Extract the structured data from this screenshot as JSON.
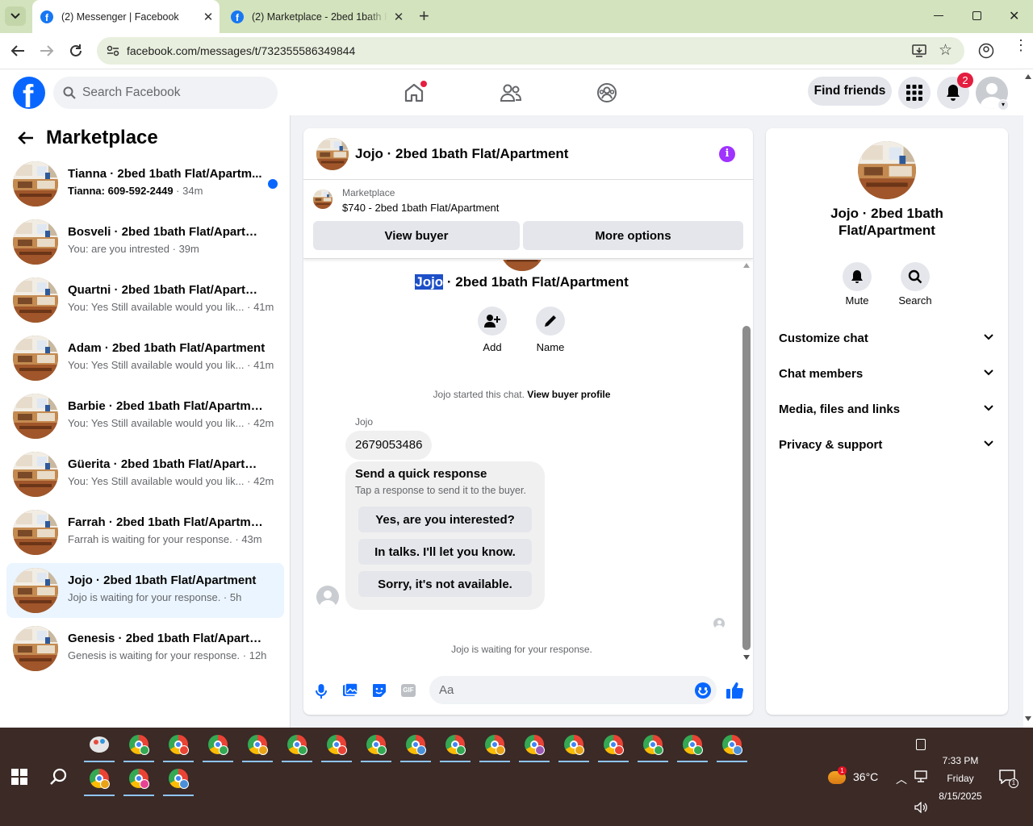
{
  "browser": {
    "tabs": [
      {
        "title": "(2) Messenger | Facebook",
        "active": true
      },
      {
        "title": "(2) Marketplace - 2bed 1bath Fl",
        "active": false
      }
    ],
    "url": "facebook.com/messages/t/732355586349844"
  },
  "fb_header": {
    "search_placeholder": "Search Facebook",
    "find_friends": "Find friends",
    "notif_count": "2"
  },
  "sidebar": {
    "title": "Marketplace",
    "conversations": [
      {
        "name": "Tianna · 2bed 1bath Flat/Apartm...",
        "preview": "Tianna: 609-592-2449",
        "time": "34m",
        "unread": true
      },
      {
        "name": "Bosveli · 2bed 1bath Flat/Apartment",
        "preview": "You: are you intrested",
        "time": "39m"
      },
      {
        "name": "Quartni · 2bed 1bath Flat/Apartment",
        "preview": "You: Yes Still available would you lik...",
        "time": "41m"
      },
      {
        "name": "Adam · 2bed 1bath Flat/Apartment",
        "preview": "You: Yes Still available would you lik...",
        "time": "41m"
      },
      {
        "name": "Barbie · 2bed 1bath Flat/Apartment",
        "preview": "You: Yes Still available would you lik...",
        "time": "42m"
      },
      {
        "name": "Güerita · 2bed 1bath Flat/Apartment",
        "preview": "You: Yes Still available would you lik...",
        "time": "42m"
      },
      {
        "name": "Farrah · 2bed 1bath Flat/Apartment",
        "preview": "Farrah is waiting for your response.",
        "time": "43m"
      },
      {
        "name": "Jojo · 2bed 1bath Flat/Apartment",
        "preview": "Jojo is waiting for your response.",
        "time": "5h",
        "active": true
      },
      {
        "name": "Genesis · 2bed 1bath Flat/Apartment",
        "preview": "Genesis is waiting for your response.",
        "time": "12h"
      }
    ]
  },
  "chat": {
    "header_name": "Jojo · 2bed 1bath Flat/Apartment",
    "marketplace_label": "Marketplace",
    "listing": "$740 - 2bed 1bath Flat/Apartment",
    "view_buyer": "View buyer",
    "more_options": "More options",
    "intro_name_highlight": "Jojo",
    "intro_name_rest": " · 2bed 1bath Flat/Apartment",
    "add_label": "Add",
    "name_label": "Name",
    "started_text": "Jojo started this chat.",
    "view_buyer_profile": "View buyer profile",
    "sender": "Jojo",
    "message": "2679053486",
    "quick_title": "Send a quick response",
    "quick_sub": "Tap a response to send it to the buyer.",
    "quick_replies": [
      "Yes, are you interested?",
      "In talks. I'll let you know.",
      "Sorry, it's not available."
    ],
    "waiting": "Jojo is waiting for your response.",
    "composer_placeholder": "Aa"
  },
  "right_panel": {
    "name_line1": "Jojo · 2bed 1bath",
    "name_line2": "Flat/Apartment",
    "mute": "Mute",
    "search": "Search",
    "sections": [
      "Customize chat",
      "Chat members",
      "Media, files and links",
      "Privacy & support"
    ]
  },
  "taskbar": {
    "weather_temp": "36°C",
    "weather_badge": "1",
    "time": "7:33 PM",
    "day": "Friday",
    "date": "8/15/2025",
    "notif_badge": "1"
  },
  "colors": {
    "fb_blue": "#0866ff",
    "messenger_purple": "#a033ff",
    "tabbar": "#d3e3bd",
    "taskbar": "#3b2a26"
  }
}
